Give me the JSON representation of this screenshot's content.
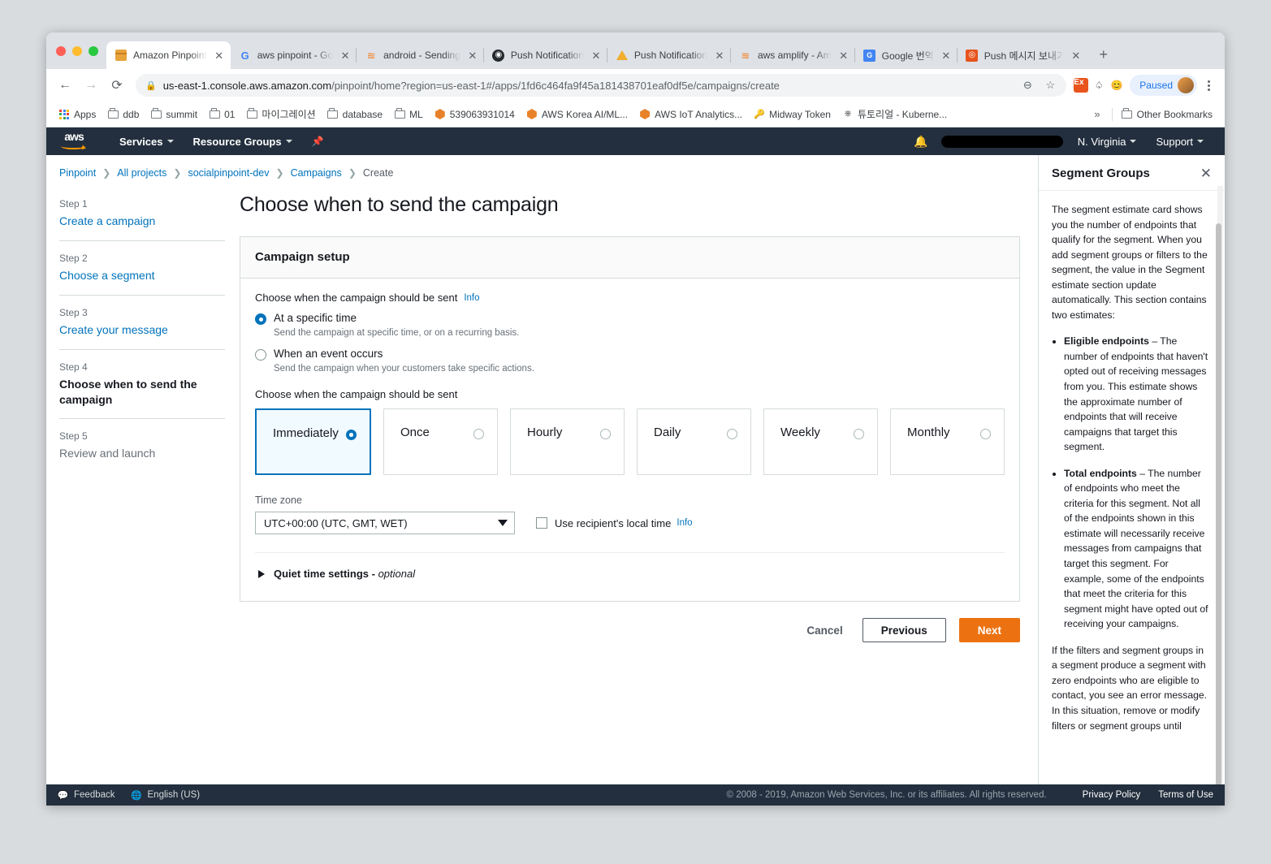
{
  "browser": {
    "tabs": [
      {
        "title": "Amazon Pinpoint",
        "icon": "box-icon",
        "active": true
      },
      {
        "title": "aws pinpoint - Go",
        "icon": "google-icon",
        "active": false
      },
      {
        "title": "android - Sending",
        "icon": "stackoverflow-icon",
        "active": false
      },
      {
        "title": "Push Notification",
        "icon": "github-icon",
        "active": false
      },
      {
        "title": "Push Notification",
        "icon": "warning-triangle-icon",
        "active": false
      },
      {
        "title": "aws amplify - Am",
        "icon": "stackoverflow-icon",
        "active": false
      },
      {
        "title": "Google 번역",
        "icon": "translate-icon",
        "active": false
      },
      {
        "title": "Push 메시지 보내기",
        "icon": "orange-icon",
        "active": false
      }
    ],
    "new_tab_label": "+",
    "close_label": "✕",
    "nav": {
      "back": "←",
      "forward": "→",
      "reload": "⟳"
    },
    "url": {
      "lock": "🔒",
      "domain": "us-east-1.console.aws.amazon.com",
      "path": "/pinpoint/home?region=us-east-1#/apps/1fd6c464fa9f45a181438701eaf0df5e/campaigns/create"
    },
    "omnibox_icons": [
      "zoom-out-icon",
      "bookmark-star-icon",
      "extension-ex-icon",
      "extension-ghost-icon",
      "extension-amazon-icon"
    ],
    "profile": {
      "label": "Paused",
      "avatar": "user-avatar"
    },
    "menu": "kebab-menu-icon",
    "bookmarks": [
      {
        "label": "Apps",
        "icon": "apps-grid-icon"
      },
      {
        "label": "ddb",
        "icon": "folder-icon"
      },
      {
        "label": "summit",
        "icon": "folder-icon"
      },
      {
        "label": "01",
        "icon": "folder-icon"
      },
      {
        "label": "마이그레이션",
        "icon": "folder-icon"
      },
      {
        "label": "database",
        "icon": "folder-icon"
      },
      {
        "label": "ML",
        "icon": "folder-icon"
      },
      {
        "label": "539063931014",
        "icon": "aws-cube-icon"
      },
      {
        "label": "AWS Korea AI/ML...",
        "icon": "aws-cube-icon"
      },
      {
        "label": "AWS IoT Analytics...",
        "icon": "aws-cube-icon"
      },
      {
        "label": "Midway Token",
        "icon": "key-icon"
      },
      {
        "label": "튜토리얼 - Kuberne...",
        "icon": "kubernetes-icon"
      }
    ],
    "bookmarks_overflow": "»",
    "other_bookmarks": {
      "label": "Other Bookmarks",
      "icon": "folder-icon"
    }
  },
  "awsnav": {
    "logo": "aws",
    "services": "Services",
    "resource_groups": "Resource Groups",
    "pin": "pin-icon",
    "bell": "bell-icon",
    "account": "",
    "region": "N. Virginia",
    "support": "Support"
  },
  "breadcrumb": [
    {
      "label": "Pinpoint",
      "current": false
    },
    {
      "label": "All projects",
      "current": false
    },
    {
      "label": "socialpinpoint-dev",
      "current": false
    },
    {
      "label": "Campaigns",
      "current": false
    },
    {
      "label": "Create",
      "current": true
    }
  ],
  "breadcrumb_separator": "❯",
  "steps": [
    {
      "num": "Step 1",
      "label": "Create a campaign",
      "state": "done"
    },
    {
      "num": "Step 2",
      "label": "Choose a segment",
      "state": "done"
    },
    {
      "num": "Step 3",
      "label": "Create your message",
      "state": "done"
    },
    {
      "num": "Step 4",
      "label": "Choose when to send the campaign",
      "state": "active"
    },
    {
      "num": "Step 5",
      "label": "Review and launch",
      "state": "future"
    }
  ],
  "main": {
    "page_title": "Choose when to send the campaign",
    "card_title": "Campaign setup",
    "send_type": {
      "label": "Choose when the campaign should be sent",
      "info": "Info",
      "options": [
        {
          "label": "At a specific time",
          "description": "Send the campaign at specific time, or on a recurring basis.",
          "selected": true
        },
        {
          "label": "When an event occurs",
          "description": "Send the campaign when your customers take specific actions.",
          "selected": false
        }
      ]
    },
    "frequency": {
      "label": "Choose when the campaign should be sent",
      "options": [
        {
          "label": "Immediately",
          "selected": true
        },
        {
          "label": "Once",
          "selected": false
        },
        {
          "label": "Hourly",
          "selected": false
        },
        {
          "label": "Daily",
          "selected": false
        },
        {
          "label": "Weekly",
          "selected": false
        },
        {
          "label": "Monthly",
          "selected": false
        }
      ]
    },
    "timezone": {
      "label": "Time zone",
      "value": "UTC+00:00 (UTC, GMT, WET)",
      "local_time_label": "Use recipient's local time",
      "local_time_info": "Info",
      "local_time_checked": false
    },
    "quiet_time": {
      "label": "Quiet time settings - ",
      "optional": "optional",
      "expanded": false
    },
    "actions": {
      "cancel": "Cancel",
      "previous": "Previous",
      "next": "Next"
    }
  },
  "help": {
    "title": "Segment Groups",
    "close": "✕",
    "paragraph1": "The segment estimate card shows you the number of endpoints that qualify for the segment. When you add segment groups or filters to the segment, the value in the Segment estimate section update automatically. This section contains two estimates:",
    "bullets": [
      {
        "term": "Eligible endpoints",
        "text": " – The number of endpoints that haven't opted out of receiving messages from you. This estimate shows the approximate number of endpoints that will receive campaigns that target this segment."
      },
      {
        "term": "Total endpoints",
        "text": " – The number of endpoints who meet the criteria for this segment. Not all of the endpoints shown in this estimate will necessarily receive messages from campaigns that target this segment. For example, some of the endpoints that meet the criteria for this segment might have opted out of receiving your campaigns."
      }
    ],
    "paragraph2": "If the filters and segment groups in a segment produce a segment with zero endpoints who are eligible to contact, you see an error message. In this situation, remove or modify filters or segment groups until"
  },
  "footer": {
    "feedback": "Feedback",
    "language": "English (US)",
    "copyright": "© 2008 - 2019, Amazon Web Services, Inc. or its affiliates. All rights reserved.",
    "privacy": "Privacy Policy",
    "terms": "Terms of Use"
  },
  "colors": {
    "aws_navy": "#232f3e",
    "aws_orange": "#ec7211",
    "link_blue": "#0073bb",
    "selected_bg": "#f1faff"
  }
}
